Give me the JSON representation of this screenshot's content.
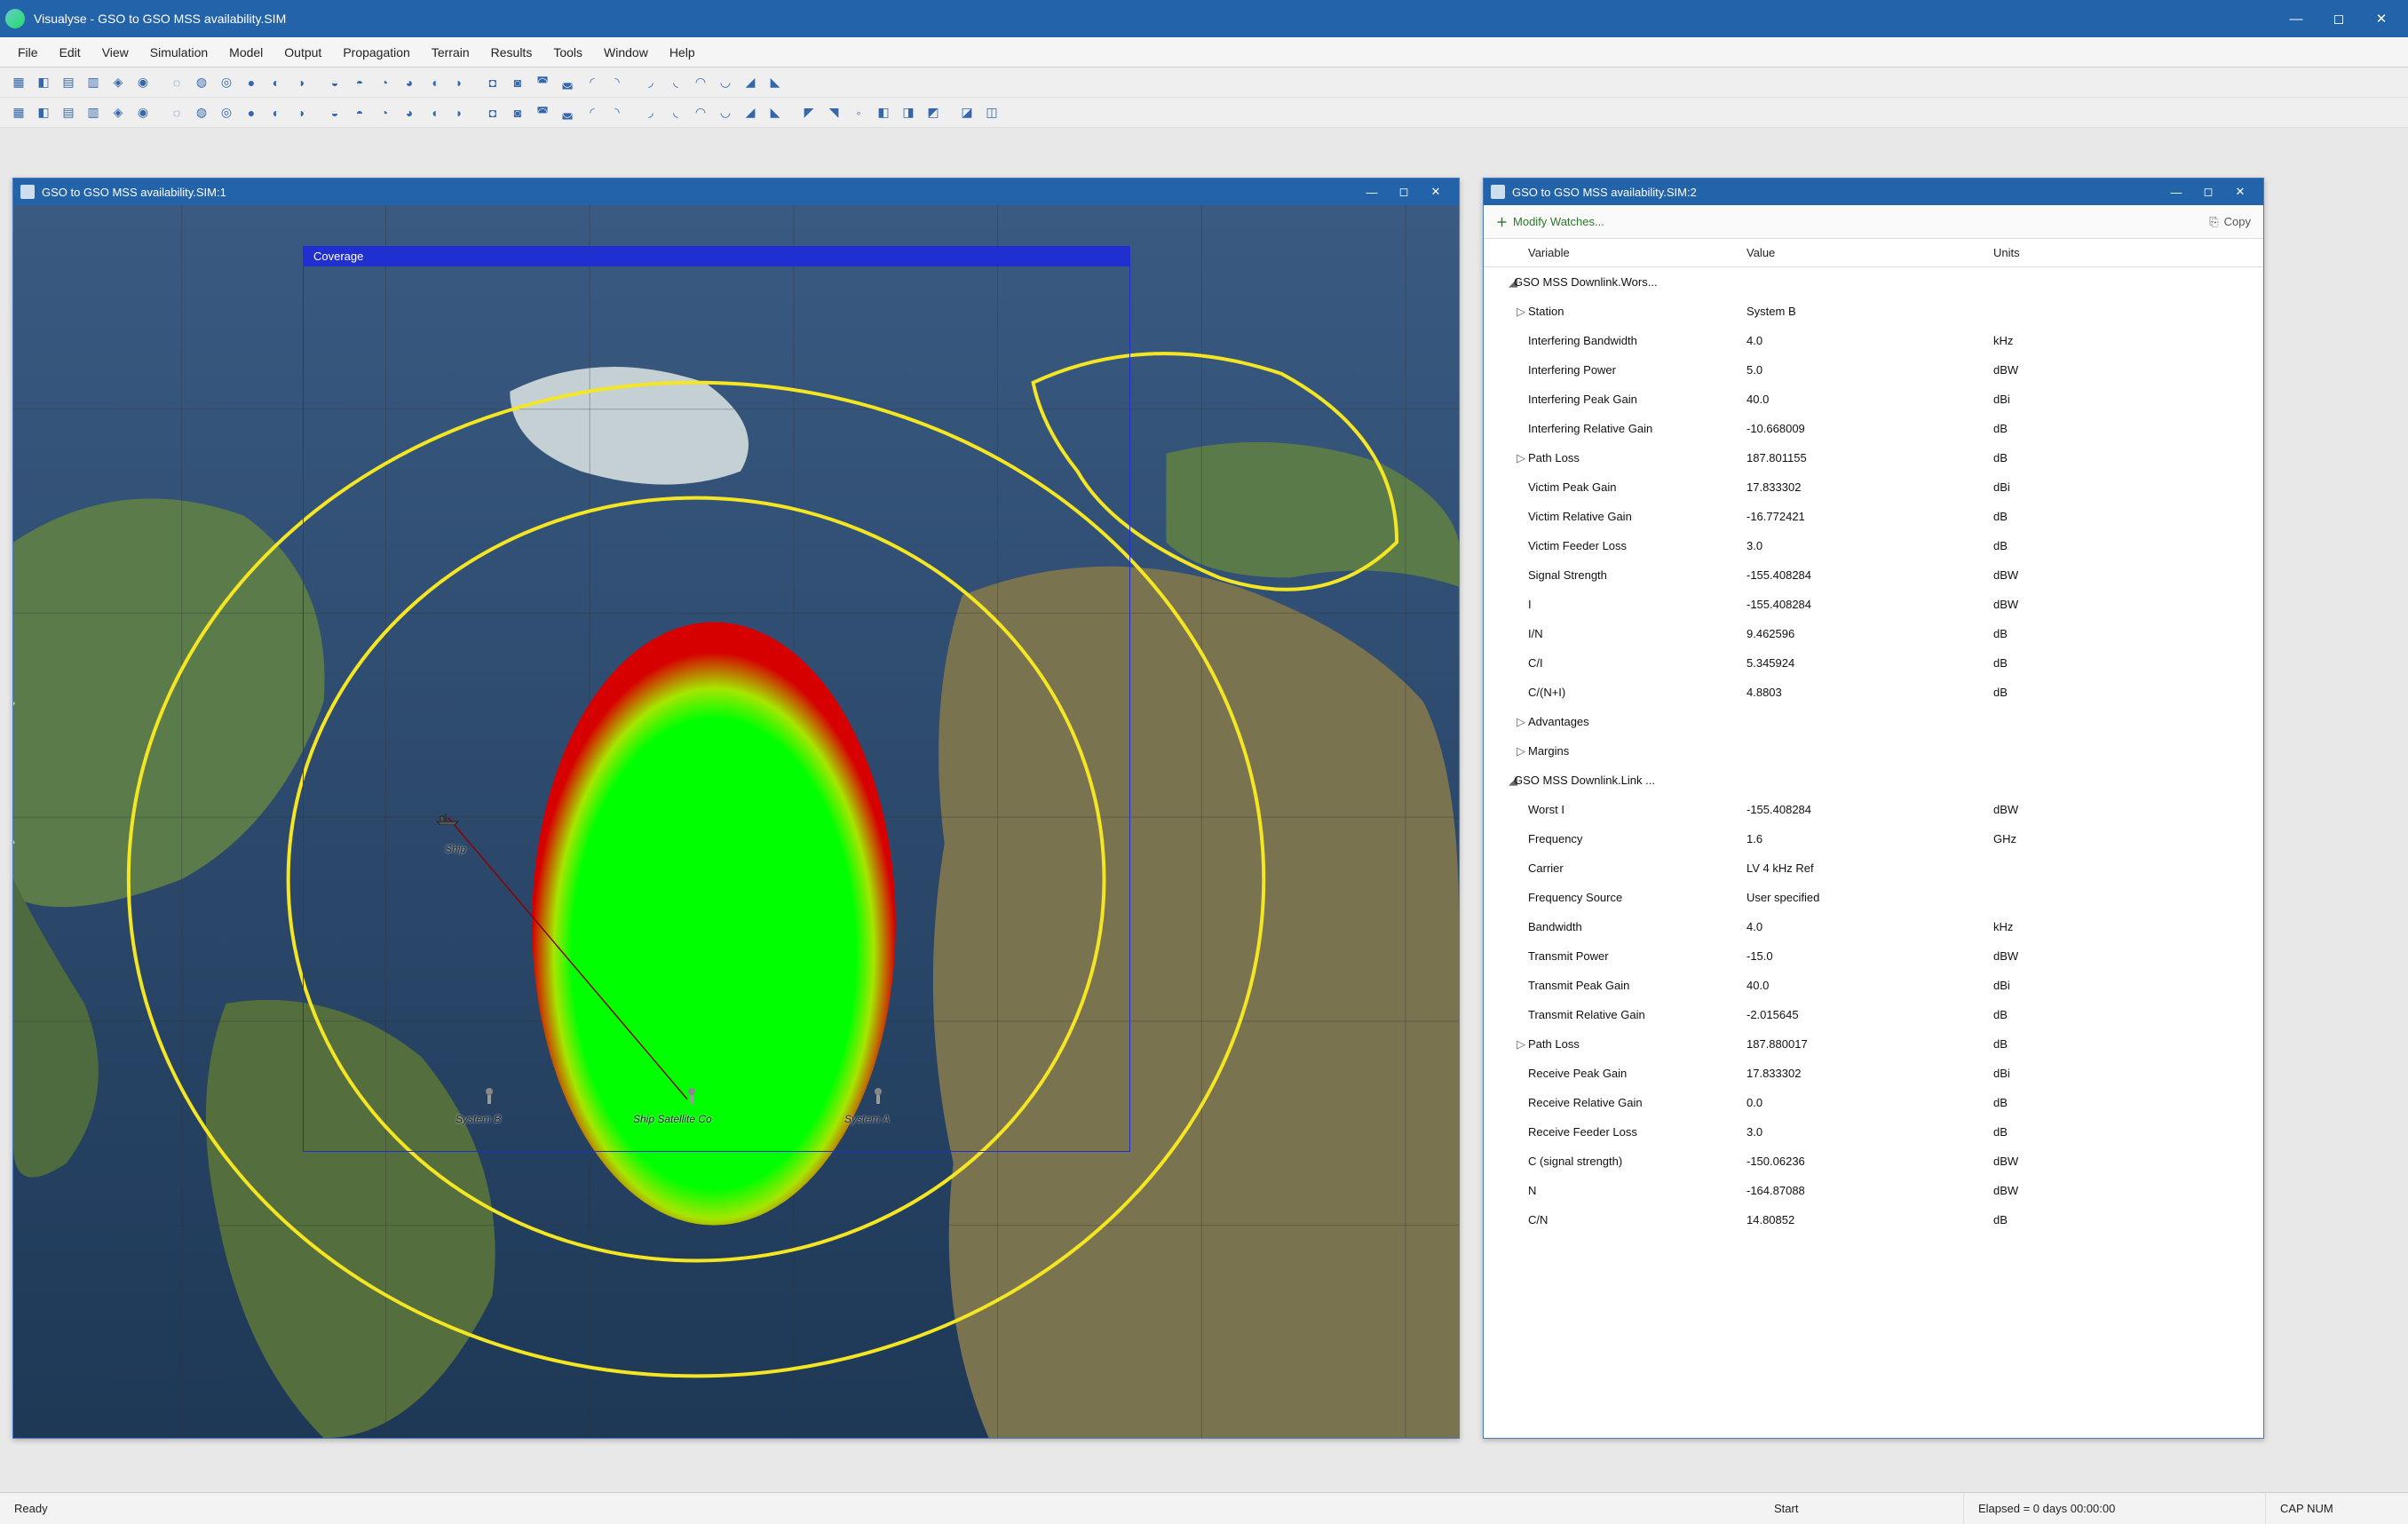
{
  "app": {
    "title": "Visualyse - GSO to GSO MSS availability.SIM"
  },
  "menu": [
    "File",
    "Edit",
    "View",
    "Simulation",
    "Model",
    "Output",
    "Propagation",
    "Terrain",
    "Results",
    "Tools",
    "Window",
    "Help"
  ],
  "windows": {
    "map": {
      "title": "GSO to GSO MSS availability.SIM:1",
      "coverage_label": "Coverage",
      "labels": {
        "ship": "Ship",
        "system_a": "System A",
        "system_b": "System B",
        "ship_sat_co": "Ship Satellite Co"
      }
    },
    "watch": {
      "title": "GSO to GSO MSS availability.SIM:2",
      "modify": "Modify Watches...",
      "copy": "Copy",
      "headers": {
        "variable": "Variable",
        "value": "Value",
        "units": "Units"
      },
      "rows": [
        {
          "type": "group",
          "tree": "◢",
          "var": "GSO MSS Downlink.Wors...",
          "val": "",
          "unit": ""
        },
        {
          "type": "child",
          "tree": "▷",
          "var": "Station",
          "val": "System B",
          "unit": ""
        },
        {
          "type": "child",
          "tree": "",
          "var": "Interfering Bandwidth",
          "val": "4.0",
          "unit": "kHz"
        },
        {
          "type": "child",
          "tree": "",
          "var": "Interfering Power",
          "val": "5.0",
          "unit": "dBW"
        },
        {
          "type": "child",
          "tree": "",
          "var": "Interfering Peak Gain",
          "val": "40.0",
          "unit": "dBi"
        },
        {
          "type": "child",
          "tree": "",
          "var": "Interfering Relative Gain",
          "val": "-10.668009",
          "unit": "dB"
        },
        {
          "type": "child",
          "tree": "▷",
          "var": "Path Loss",
          "val": "187.801155",
          "unit": "dB"
        },
        {
          "type": "child",
          "tree": "",
          "var": "Victim Peak Gain",
          "val": "17.833302",
          "unit": "dBi"
        },
        {
          "type": "child",
          "tree": "",
          "var": "Victim Relative Gain",
          "val": "-16.772421",
          "unit": "dB"
        },
        {
          "type": "child",
          "tree": "",
          "var": "Victim Feeder Loss",
          "val": "3.0",
          "unit": "dB"
        },
        {
          "type": "child",
          "tree": "",
          "var": "Signal Strength",
          "val": "-155.408284",
          "unit": "dBW"
        },
        {
          "type": "child",
          "tree": "",
          "var": "I",
          "val": "-155.408284",
          "unit": "dBW"
        },
        {
          "type": "child",
          "tree": "",
          "var": "I/N",
          "val": "9.462596",
          "unit": "dB"
        },
        {
          "type": "child",
          "tree": "",
          "var": "C/I",
          "val": "5.345924",
          "unit": "dB"
        },
        {
          "type": "child",
          "tree": "",
          "var": "C/(N+I)",
          "val": "4.8803",
          "unit": "dB"
        },
        {
          "type": "child",
          "tree": "▷",
          "var": "Advantages",
          "val": "",
          "unit": ""
        },
        {
          "type": "child",
          "tree": "▷",
          "var": "Margins",
          "val": "",
          "unit": ""
        },
        {
          "type": "group",
          "tree": "◢",
          "var": "GSO MSS Downlink.Link ...",
          "val": "",
          "unit": ""
        },
        {
          "type": "child",
          "tree": "",
          "var": "Worst I",
          "val": "-155.408284",
          "unit": "dBW"
        },
        {
          "type": "child",
          "tree": "",
          "var": "Frequency",
          "val": "1.6",
          "unit": "GHz"
        },
        {
          "type": "child",
          "tree": "",
          "var": "Carrier",
          "val": "LV 4 kHz Ref",
          "unit": ""
        },
        {
          "type": "child",
          "tree": "",
          "var": "Frequency Source",
          "val": "User specified",
          "unit": ""
        },
        {
          "type": "child",
          "tree": "",
          "var": "Bandwidth",
          "val": "4.0",
          "unit": "kHz"
        },
        {
          "type": "child",
          "tree": "",
          "var": "Transmit Power",
          "val": "-15.0",
          "unit": "dBW"
        },
        {
          "type": "child",
          "tree": "",
          "var": "Transmit Peak Gain",
          "val": "40.0",
          "unit": "dBi"
        },
        {
          "type": "child",
          "tree": "",
          "var": "Transmit Relative Gain",
          "val": "-2.015645",
          "unit": "dB"
        },
        {
          "type": "child",
          "tree": "▷",
          "var": "Path Loss",
          "val": "187.880017",
          "unit": "dB"
        },
        {
          "type": "child",
          "tree": "",
          "var": "Receive Peak Gain",
          "val": "17.833302",
          "unit": "dBi"
        },
        {
          "type": "child",
          "tree": "",
          "var": "Receive Relative Gain",
          "val": "0.0",
          "unit": "dB"
        },
        {
          "type": "child",
          "tree": "",
          "var": "Receive Feeder Loss",
          "val": "3.0",
          "unit": "dB"
        },
        {
          "type": "child",
          "tree": "",
          "var": "C (signal strength)",
          "val": "-150.06236",
          "unit": "dBW"
        },
        {
          "type": "child",
          "tree": "",
          "var": "N",
          "val": "-164.87088",
          "unit": "dBW"
        },
        {
          "type": "child",
          "tree": "",
          "var": "C/N",
          "val": "14.80852",
          "unit": "dB"
        }
      ]
    }
  },
  "status": {
    "ready": "Ready",
    "start": "Start",
    "elapsed": "Elapsed = 0 days 00:00:00",
    "caps": "CAP NUM"
  }
}
